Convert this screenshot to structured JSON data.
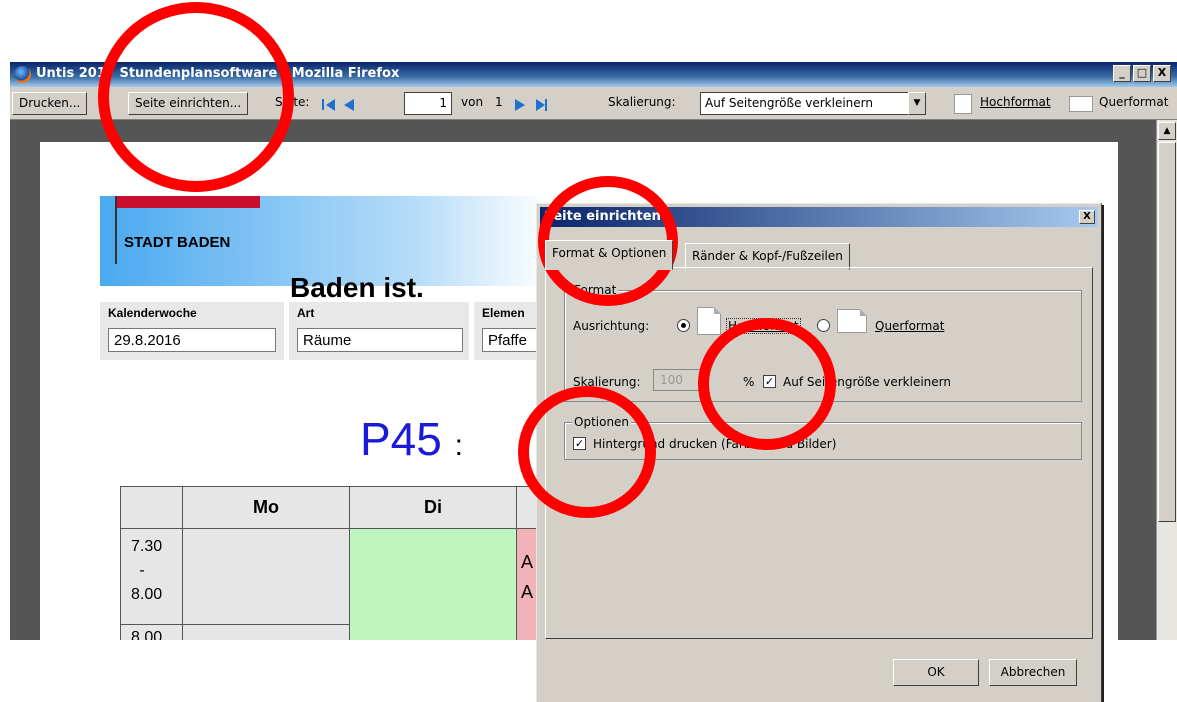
{
  "window": {
    "title": "Untis 2017 Stundenplansoftware - Mozilla Firefox",
    "minimize": "_",
    "maximize": "□",
    "close": "X"
  },
  "toolbar": {
    "print": "Drucken...",
    "page_setup": "Seite einrichten...",
    "page_label": "Seite:",
    "page_value": "1",
    "page_of": "von",
    "page_total": "1",
    "scale_label": "Skalierung:",
    "scale_value": "Auf Seitengröße verkleinern",
    "portrait": "Hochformat",
    "landscape": "Querformat"
  },
  "page": {
    "org": "STADT BADEN",
    "slogan": "Baden ist.",
    "fields": [
      {
        "label": "Kalenderwoche",
        "value": "29.8.2016"
      },
      {
        "label": "Art",
        "value": "Räume"
      },
      {
        "label": "Elemen",
        "value": "Pfaffe"
      }
    ],
    "room": "P45",
    "room_suffix": ":",
    "days": [
      "",
      "Mo",
      "Di",
      ""
    ],
    "times": [
      {
        "start": "7.30",
        "sep": "-",
        "end": "8.00"
      },
      {
        "start": "8.00"
      }
    ],
    "lesson_text": [
      "A",
      "A"
    ]
  },
  "dialog": {
    "title": "Seite einrichten",
    "tabs": [
      "Format & Optionen",
      "Ränder & Kopf-/Fußzeilen"
    ],
    "format_legend": "Format",
    "orientation_label": "Ausrichtung:",
    "portrait": "Hochformat",
    "landscape": "Querformat",
    "scale_label": "Skalierung:",
    "scale_value": "100",
    "percent": "%",
    "shrink_label": "Auf Seitengröße verkleinern",
    "options_legend": "Optionen",
    "background_label": "Hintergrund drucken (Farben und Bilder)",
    "ok": "OK",
    "cancel": "Abbrechen"
  },
  "colors": {
    "annotation": "#ff0000",
    "title_bar": "#0a246a",
    "room": "#1a1ad8",
    "di_cell": "#bff5bf",
    "wed_cell": "#f2b3b8"
  }
}
